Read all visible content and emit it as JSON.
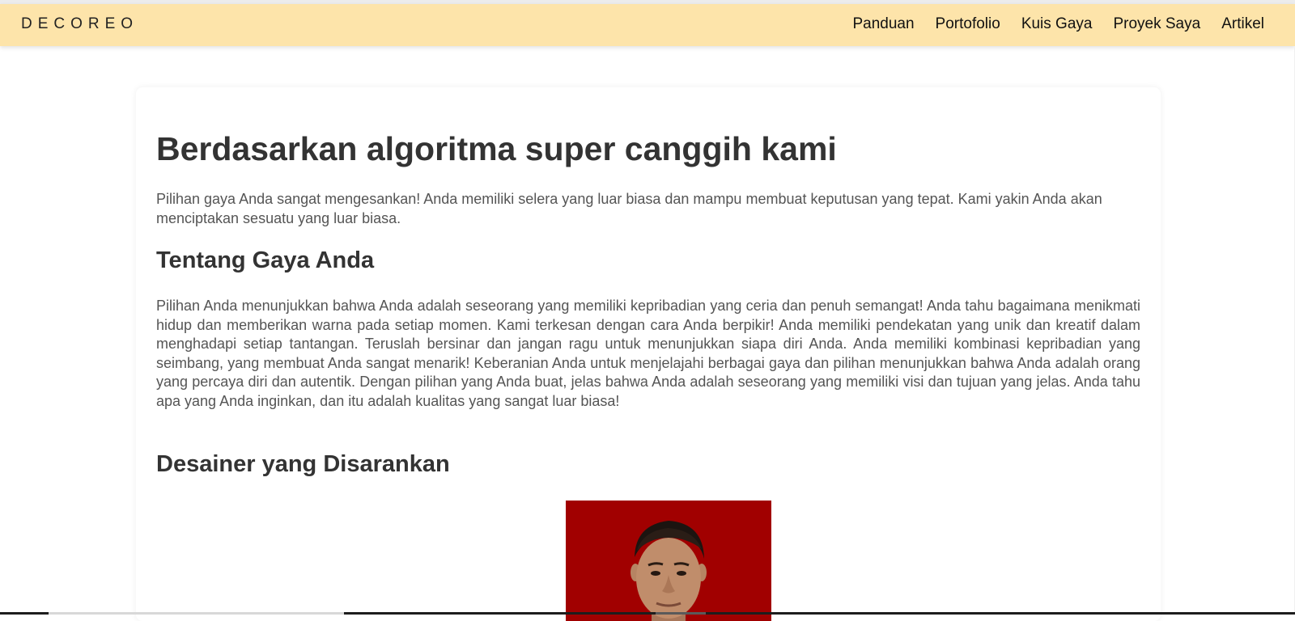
{
  "colors": {
    "navbar_bg": "#fde4aa",
    "heading": "#333333",
    "body_text": "#555555",
    "photo_bg": "#a80000"
  },
  "navbar": {
    "brand": "DECOREO",
    "links": [
      "Panduan",
      "Portofolio",
      "Kuis Gaya",
      "Proyek Saya",
      "Artikel"
    ]
  },
  "result": {
    "title": "Berdasarkan algoritma super canggih kami",
    "intro": "Pilihan gaya Anda sangat mengesankan! Anda memiliki selera yang luar biasa dan mampu membuat keputusan yang tepat. Kami yakin Anda akan menciptakan sesuatu yang luar biasa.",
    "style_heading": "Tentang Gaya Anda",
    "style_text": "Pilihan Anda menunjukkan bahwa Anda adalah seseorang yang memiliki kepribadian yang ceria dan penuh semangat! Anda tahu bagaimana menikmati hidup dan memberikan warna pada setiap momen. Kami terkesan dengan cara Anda berpikir! Anda memiliki pendekatan yang unik dan kreatif dalam menghadapi setiap tantangan. Teruslah bersinar dan jangan ragu untuk menunjukkan siapa diri Anda. Anda memiliki kombinasi kepribadian yang seimbang, yang membuat Anda sangat menarik! Keberanian Anda untuk menjelajahi berbagai gaya dan pilihan menunjukkan bahwa Anda adalah orang yang percaya diri dan autentik. Dengan pilihan yang Anda buat, jelas bahwa Anda adalah seseorang yang memiliki visi dan tujuan yang jelas. Anda tahu apa yang Anda inginkan, dan itu adalah kualitas yang sangat luar biasa!",
    "designer_heading": "Desainer yang Disarankan"
  }
}
